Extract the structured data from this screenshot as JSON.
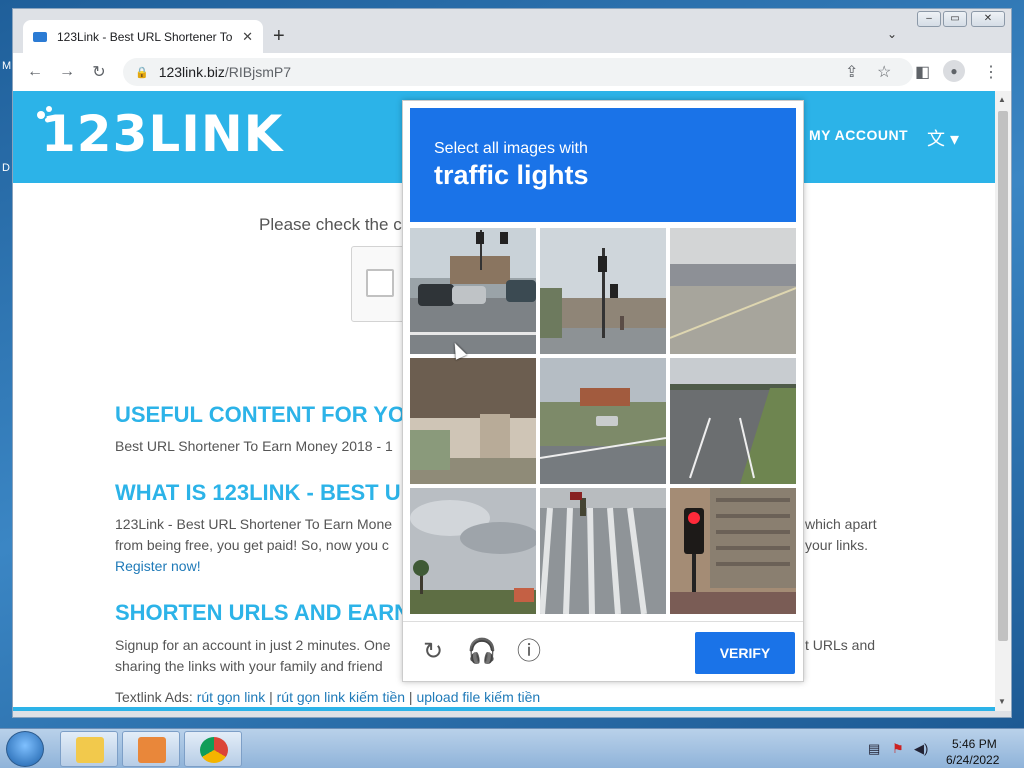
{
  "desktop": {
    "glyphs": [
      "M",
      "D"
    ]
  },
  "browser": {
    "tab_title": "123Link - Best URL Shortener To",
    "url_host": "123link.biz",
    "url_path": "/RIBjsmP7"
  },
  "site": {
    "logo": "123LINK",
    "my_account": "MY ACCOUNT",
    "check_text": "Please check the ca",
    "h_useful": "USEFUL CONTENT FOR YO",
    "p_useful": "Best URL Shortener To Earn Money 2018 - 1",
    "h_what": "WHAT IS 123LINK - BEST U",
    "p_what_1": "123Link - Best URL Shortener To Earn Mone",
    "p_what_1_right": "which apart",
    "p_what_2": "from being free, you get paid! So, now you c",
    "p_what_2_right": "your links.",
    "register": "Register now!",
    "h_shorten": "SHORTEN URLS AND EARN",
    "p_shorten_1": "Signup for an account in just 2 minutes. One",
    "p_shorten_1_right": "t URLs and",
    "p_shorten_2": "sharing the links with your family and friend",
    "textlink_label": "Textlink Ads:",
    "textlinks": [
      "rút gọn link",
      "rút gọn link kiếm tiền",
      "upload file kiếm tiền"
    ],
    "sep": "|"
  },
  "captcha": {
    "line1": "Select all images with",
    "line2": "traffic lights",
    "verify": "VERIFY",
    "tiles": [
      "intersection-cars",
      "street-corner-traffic-light",
      "bridge-road",
      "overpass-underside",
      "highway-exit",
      "divided-highway",
      "cloudy-sky-palms",
      "crosswalk-pedestrian",
      "red-traffic-light-building"
    ]
  },
  "taskbar": {
    "time": "5:46 PM",
    "date": "6/24/2022"
  },
  "colors": {
    "brand": "#2cb3e8",
    "captcha_blue": "#1a73e8"
  }
}
